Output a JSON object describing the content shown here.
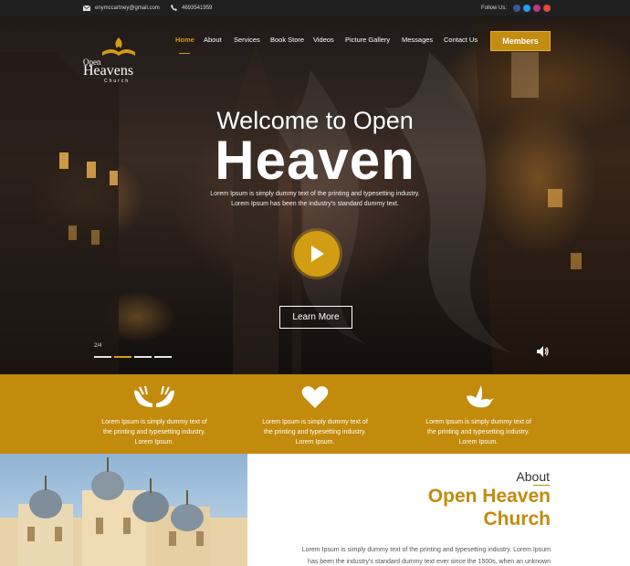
{
  "topbar": {
    "email": "enymccartney@gmail.com",
    "phone": "4693541959",
    "follow_label": "Follow Us:",
    "social_icons": [
      "facebook-icon",
      "twitter-icon",
      "instagram-icon",
      "google-plus-icon"
    ],
    "social_colors": [
      "#3b5998",
      "#1da1f2",
      "#c13584",
      "#dd4b39"
    ]
  },
  "logo": {
    "line1": "Open",
    "line2": "Heavens",
    "line3": "Church"
  },
  "nav": {
    "items": [
      "Home",
      "About",
      "Services",
      "Book Store",
      "Videos",
      "Picture Gallery",
      "Messages",
      "Contact Us"
    ],
    "active": "Home",
    "members_label": "Members"
  },
  "hero": {
    "welcome": "Welcome to Open",
    "big": "Heaven",
    "sub_line1": "Lorem Ipsum is simply dummy text of the printing and typesetting industry.",
    "sub_line2": "Lorem Ipsum has been the industry's standard dummy text.",
    "learn_more": "Learn More",
    "slide_counter": "2/4",
    "slides_total": 4,
    "active_slide": 2
  },
  "features": [
    {
      "icon": "praying-hands-icon",
      "line1": "Lorem Ipsum is simply dummy text of",
      "line2": "the printing and typesetting industry.",
      "line3": "Lorem Ipsum."
    },
    {
      "icon": "heart-icon",
      "line1": "Lorem Ipsum is simply dummy text of",
      "line2": "the printing and typesetting industry.",
      "line3": "Lorem Ipsum."
    },
    {
      "icon": "dove-icon",
      "line1": "Lorem Ipsum is simply dummy text of",
      "line2": "the printing and typesetting industry.",
      "line3": "Lorem Ipsum."
    }
  ],
  "about": {
    "label": "About",
    "title_line1": "Open Heaven",
    "title_line2": "Church",
    "text_line1": "Lorem Ipsum is simply dummy text of the printing and typesetting industry. Lorem Ipsum",
    "text_line2": "has been the industry's standard dummy text ever since the 1500s, when an unknown"
  },
  "colors": {
    "accent": "#c28b0c",
    "topbar": "#202020",
    "white": "#ffffff"
  }
}
